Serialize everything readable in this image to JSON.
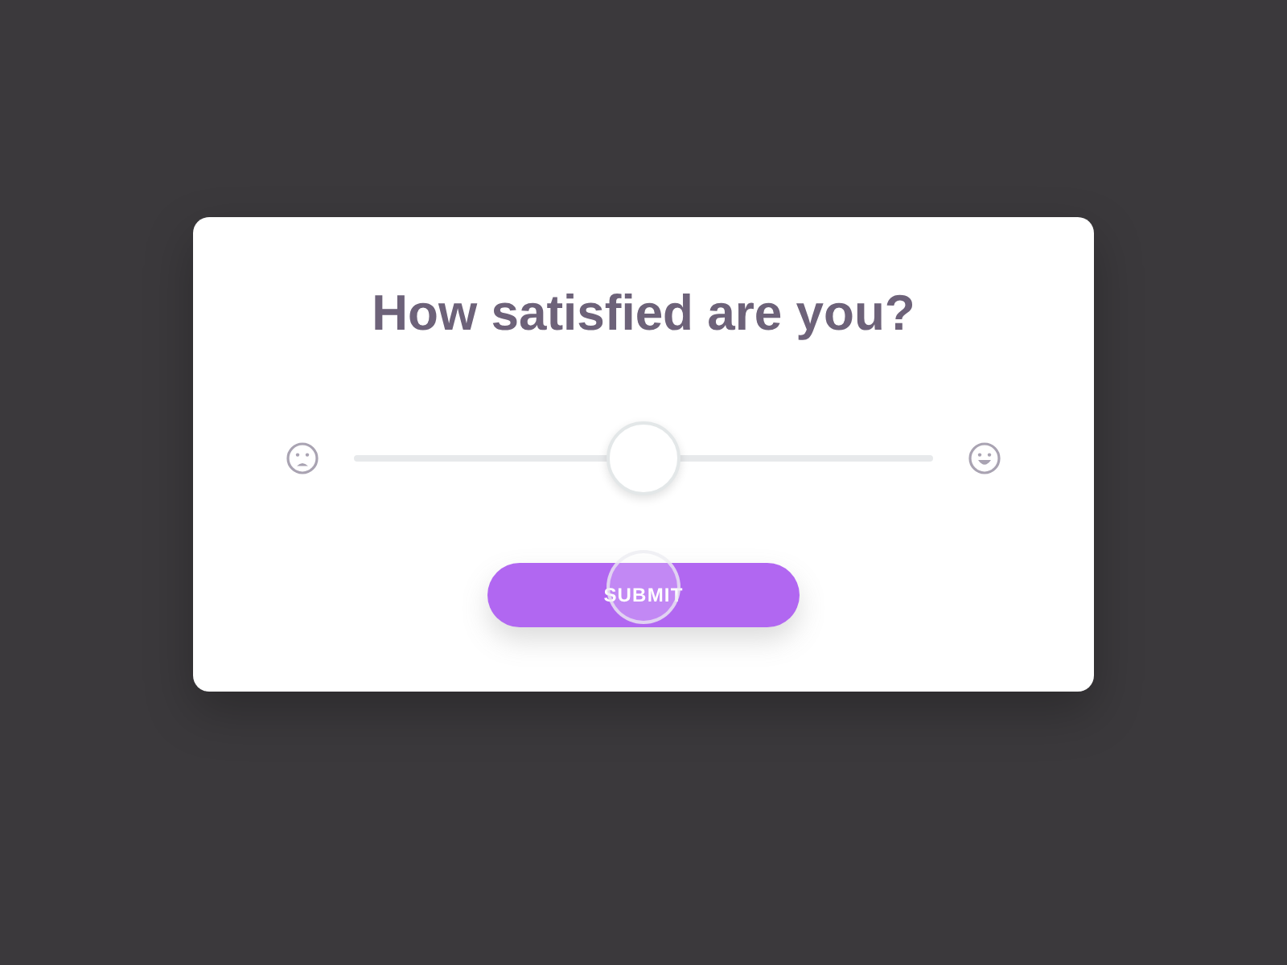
{
  "card": {
    "title": "How satisfied are you?"
  },
  "rating_slider": {
    "level": 0.5
  },
  "submit_button": {
    "label": "SUBMIT"
  }
}
